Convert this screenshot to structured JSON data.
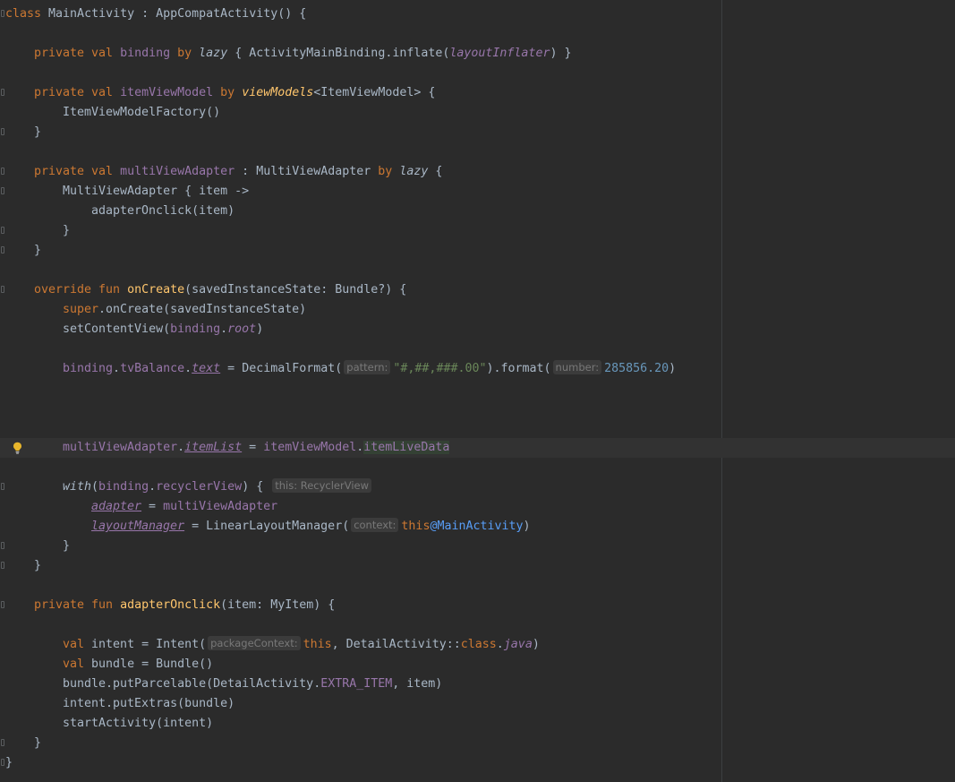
{
  "hints": {
    "pattern": "pattern:",
    "number": "number:",
    "this_recycler": "this: RecyclerView",
    "context": "context:",
    "package_context": "packageContext:"
  },
  "colors": {
    "background": "#2b2b2b",
    "current_line": "#323232",
    "keyword": "#cc7832",
    "function": "#ffc66d",
    "property": "#9876aa",
    "string": "#6a8759",
    "number": "#6897bb",
    "default_text": "#a9b7c6"
  },
  "icons": {
    "intention": "lightbulb-icon",
    "fold": "fold-marker-icon"
  }
}
